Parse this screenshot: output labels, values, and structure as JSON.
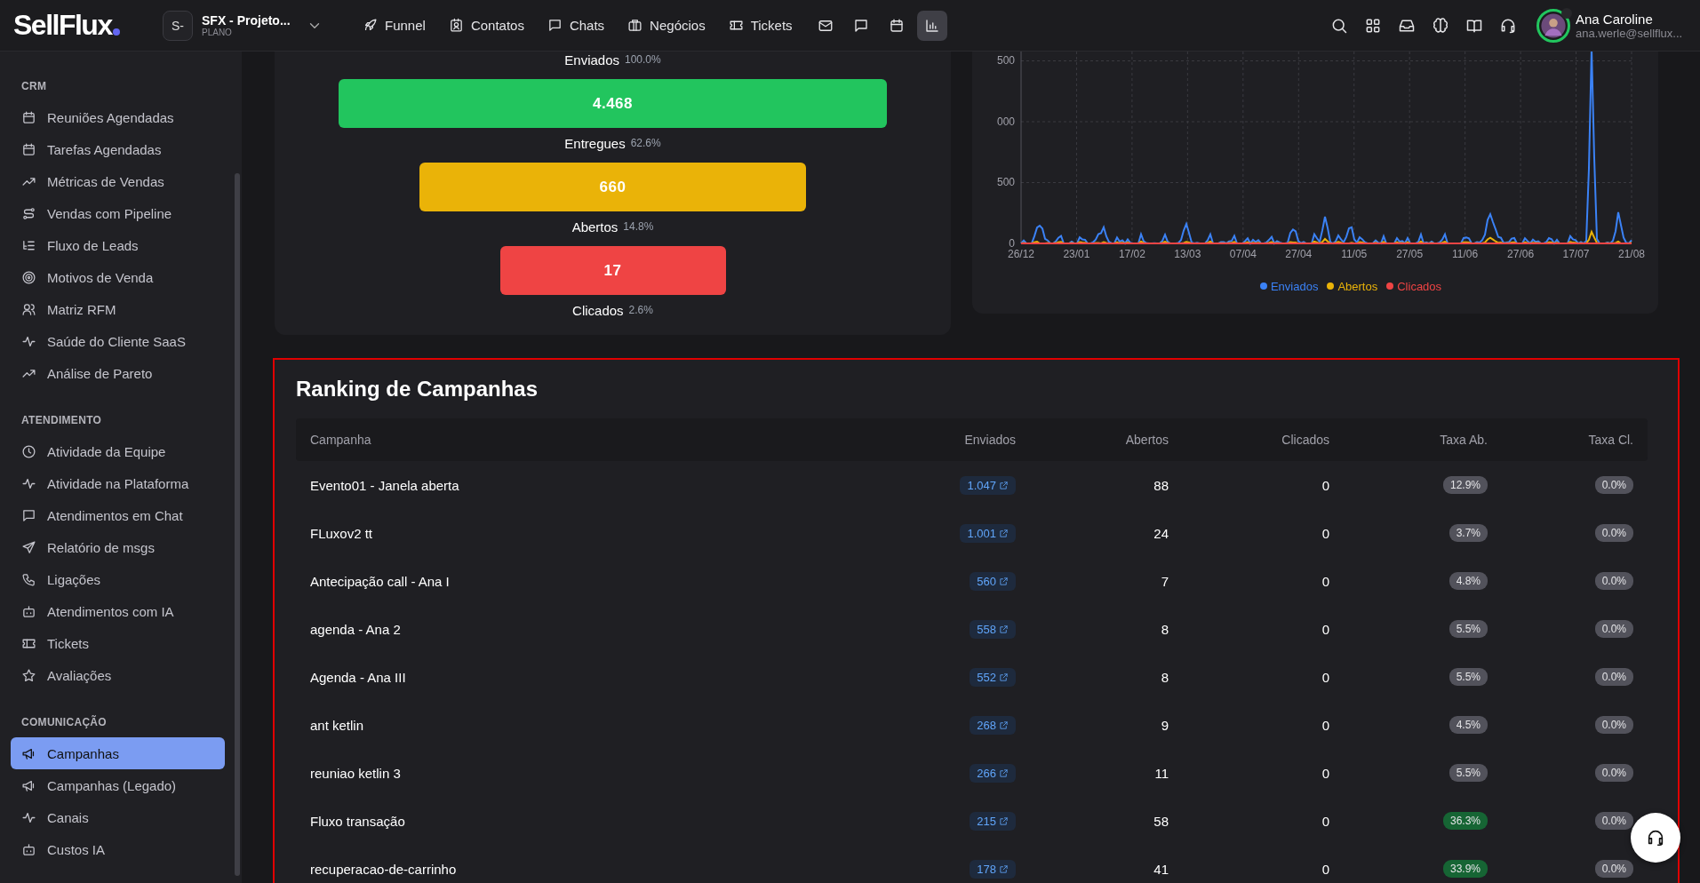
{
  "topbar": {
    "logo": "SellFlux",
    "project": {
      "initials": "S-",
      "name": "SFX - Projeto...",
      "plan": "PLANO"
    },
    "nav": [
      {
        "label": "Funnel"
      },
      {
        "label": "Contatos"
      },
      {
        "label": "Chats"
      },
      {
        "label": "Negócios"
      },
      {
        "label": "Tickets"
      }
    ],
    "icon_buttons": [
      {
        "selected": false
      },
      {
        "selected": false
      },
      {
        "selected": false
      },
      {
        "selected": true
      }
    ],
    "user": {
      "name": "Ana Caroline",
      "email": "ana.werle@sellflux..."
    }
  },
  "sidebar": {
    "sections": [
      {
        "title": "CRM",
        "items": [
          {
            "label": "Reuniões Agendadas",
            "selected": false
          },
          {
            "label": "Tarefas Agendadas",
            "selected": false
          },
          {
            "label": "Métricas de Vendas",
            "selected": false
          },
          {
            "label": "Vendas com Pipeline",
            "selected": false
          },
          {
            "label": "Fluxo de Leads",
            "selected": false
          },
          {
            "label": "Motivos de Venda",
            "selected": false
          },
          {
            "label": "Matriz RFM",
            "selected": false
          },
          {
            "label": "Saúde do Cliente SaaS",
            "selected": false
          },
          {
            "label": "Análise de Pareto",
            "selected": false
          }
        ]
      },
      {
        "title": "ATENDIMENTO",
        "items": [
          {
            "label": "Atividade da Equipe",
            "selected": false
          },
          {
            "label": "Atividade na Plataforma",
            "selected": false
          },
          {
            "label": "Atendimentos em Chat",
            "selected": false
          },
          {
            "label": "Relatório de msgs",
            "selected": false
          },
          {
            "label": "Ligações",
            "selected": false
          },
          {
            "label": "Atendimentos com IA",
            "selected": false
          },
          {
            "label": "Tickets",
            "selected": false
          },
          {
            "label": "Avaliações",
            "selected": false
          }
        ]
      },
      {
        "title": "COMUNICAÇÃO",
        "items": [
          {
            "label": "Campanhas",
            "selected": true
          },
          {
            "label": "Campanhas (Legado)",
            "selected": false
          },
          {
            "label": "Canais",
            "selected": false
          },
          {
            "label": "Custos IA",
            "selected": false
          }
        ]
      }
    ]
  },
  "funnel": {
    "stages": [
      {
        "label": "Enviados",
        "percent": "100.0%"
      },
      {
        "value": "4.468",
        "color": "#22c55e"
      },
      {
        "label": "Entregues",
        "percent": "62.6%"
      },
      {
        "value": "660",
        "color": "#eab308"
      },
      {
        "label": "Abertos",
        "percent": "14.8%"
      },
      {
        "value": "17",
        "color": "#ef4444"
      },
      {
        "label": "Clicados",
        "percent": "2.6%"
      }
    ]
  },
  "timeline": {
    "y_labels": [
      "500",
      "000",
      "500",
      "0"
    ],
    "x_labels": [
      "26/12",
      "23/01",
      "17/02",
      "13/03",
      "07/04",
      "27/04",
      "11/05",
      "27/05",
      "11/06",
      "27/06",
      "17/07",
      "21/08"
    ],
    "legend": [
      {
        "label": "Enviados",
        "color": "#3b82f6"
      },
      {
        "label": "Abertos",
        "color": "#eab308"
      },
      {
        "label": "Clicados",
        "color": "#ef4444"
      }
    ]
  },
  "ranking": {
    "title": "Ranking de Campanhas",
    "columns": [
      "Campanha",
      "Enviados",
      "Abertos",
      "Clicados",
      "Taxa Ab.",
      "Taxa Cl."
    ],
    "rows": [
      {
        "name": "Evento01 - Janela aberta",
        "sent": "1.047",
        "opened": "88",
        "clicked": "0",
        "open_rate": {
          "text": "12.9%",
          "color": "#52525b"
        },
        "click_rate": {
          "text": "0.0%",
          "color": "#52525b"
        }
      },
      {
        "name": "FLuxov2 tt",
        "sent": "1.001",
        "opened": "24",
        "clicked": "0",
        "open_rate": {
          "text": "3.7%",
          "color": "#52525b"
        },
        "click_rate": {
          "text": "0.0%",
          "color": "#52525b"
        }
      },
      {
        "name": "Antecipação call - Ana I",
        "sent": "560",
        "opened": "7",
        "clicked": "0",
        "open_rate": {
          "text": "4.8%",
          "color": "#52525b"
        },
        "click_rate": {
          "text": "0.0%",
          "color": "#52525b"
        }
      },
      {
        "name": "agenda - Ana 2",
        "sent": "558",
        "opened": "8",
        "clicked": "0",
        "open_rate": {
          "text": "5.5%",
          "color": "#52525b"
        },
        "click_rate": {
          "text": "0.0%",
          "color": "#52525b"
        }
      },
      {
        "name": "Agenda - Ana III",
        "sent": "552",
        "opened": "8",
        "clicked": "0",
        "open_rate": {
          "text": "5.5%",
          "color": "#52525b"
        },
        "click_rate": {
          "text": "0.0%",
          "color": "#52525b"
        }
      },
      {
        "name": "ant ketlin",
        "sent": "268",
        "opened": "9",
        "clicked": "0",
        "open_rate": {
          "text": "4.5%",
          "color": "#52525b"
        },
        "click_rate": {
          "text": "0.0%",
          "color": "#52525b"
        }
      },
      {
        "name": "reuniao ketlin 3",
        "sent": "266",
        "opened": "11",
        "clicked": "0",
        "open_rate": {
          "text": "5.5%",
          "color": "#52525b"
        },
        "click_rate": {
          "text": "0.0%",
          "color": "#52525b"
        }
      },
      {
        "name": "Fluxo transação",
        "sent": "215",
        "opened": "58",
        "clicked": "0",
        "open_rate": {
          "text": "36.3%",
          "color": "#166534"
        },
        "click_rate": {
          "text": "0.0%",
          "color": "#52525b"
        }
      },
      {
        "name": "recuperacao-de-carrinho",
        "sent": "178",
        "opened": "41",
        "clicked": "0",
        "open_rate": {
          "text": "33.9%",
          "color": "#166534"
        },
        "click_rate": {
          "text": "0.0%",
          "color": "#52525b"
        }
      }
    ]
  }
}
